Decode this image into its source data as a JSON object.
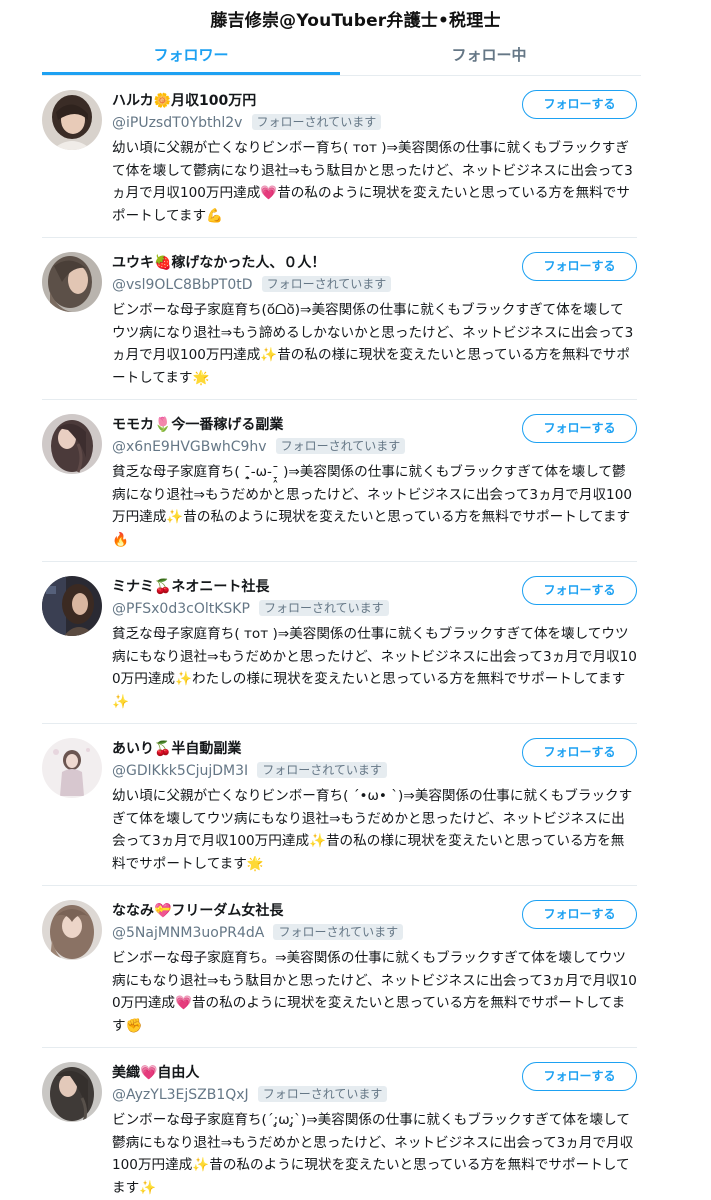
{
  "header": {
    "title": "藤吉修崇@YouTuber弁護士•税理士"
  },
  "tabs": [
    {
      "label": "フォロワー",
      "active": true
    },
    {
      "label": "フォロー中",
      "active": false
    }
  ],
  "colors": {
    "accent": "#1da1f2",
    "muted": "#657786",
    "badge_bg": "#e6ecf0"
  },
  "follows_you_label": "フォローされています",
  "follow_button_label": "フォローする",
  "users": [
    {
      "name": "ハルカ🌼月収100万円",
      "handle": "@iPUzsdT0Ybthl2v",
      "bio": "幼い頃に父親が亡くなりビンボー育ち( ᴛᴏᴛ )⇒美容関係の仕事に就くもブラックすぎて体を壊して鬱病になり退社⇒もう駄目かと思ったけど、ネットビジネスに出会って3ヵ月で月収100万円達成💗昔の私のように現状を変えたいと思っている方を無料でサポートしてます💪",
      "avatar": "avatar-1"
    },
    {
      "name": "ユウキ🍓稼げなかった人、０人！",
      "handle": "@vsl9OLC8BbPT0tD",
      "bio": "ビンボーな母子家庭育ち(o᷄ᗝo᷅)⇒美容関係の仕事に就くもブラックすぎて体を壊してウツ病になり退社⇒もう諦めるしかないかと思ったけど、ネットビジネスに出会って3ヵ月で月収100万円達成✨昔の私の様に現状を変えたいと思っている方を無料でサポートしてます🌟",
      "avatar": "avatar-2"
    },
    {
      "name": "モモカ🌷今一番稼げる副業",
      "handle": "@x6nE9HVGBwhC9hv",
      "bio": "貧乏な母子家庭育ち( ˉ̞̭-ω-ˉ̞̭ )⇒美容関係の仕事に就くもブラックすぎて体を壊して鬱病になり退社⇒もうだめかと思ったけど、ネットビジネスに出会って3ヵ月で月収100万円達成✨昔の私のように現状を変えたいと思っている方を無料でサポートしてます🔥",
      "avatar": "avatar-3"
    },
    {
      "name": "ミナミ🍒ネオニート社長",
      "handle": "@PFSx0d3cOltKSKP",
      "bio": "貧乏な母子家庭育ち( ᴛᴏᴛ )⇒美容関係の仕事に就くもブラックすぎて体を壊してウツ病にもなり退社⇒もうだめかと思ったけど、ネットビジネスに出会って3ヵ月で月収100万円達成✨わたしの様に現状を変えたいと思っている方を無料でサポートしてます✨",
      "avatar": "avatar-4"
    },
    {
      "name": "あいり🍒半自動副業",
      "handle": "@GDlKkk5CjujDM3I",
      "bio": "幼い頃に父親が亡くなりビンボー育ち( ˊ•ω• ˋ)⇒美容関係の仕事に就くもブラックすぎて体を壊してウツ病にもなり退社⇒もうだめかと思ったけど、ネットビジネスに出会って3ヵ月で月収100万円達成✨昔の私の様に現状を変えたいと思っている方を無料でサポートしてます🌟",
      "avatar": "avatar-5"
    },
    {
      "name": "ななみ💝フリーダム女社長",
      "handle": "@5NajMNM3uoPR4dA",
      "bio": "ビンボーな母子家庭育ち。⇒美容関係の仕事に就くもブラックすぎて体を壊してウツ病にもなり退社⇒もう駄目かと思ったけど、ネットビジネスに出会って3ヵ月で月収100万円達成💗昔の私のように現状を変えたいと思っている方を無料でサポートしてます✊",
      "avatar": "avatar-6"
    },
    {
      "name": "美織💗自由人",
      "handle": "@AyzYL3EjSZB1QxJ",
      "bio": "ビンボーな母子家庭育ち(ˊ;̥ω;̥ˋ)⇒美容関係の仕事に就くもブラックすぎて体を壊して鬱病にもなり退社⇒もうだめかと思ったけど、ネットビジネスに出会って3ヵ月で月収100万円達成✨昔の私のように現状を変えたいと思っている方を無料でサポートしてます✨",
      "avatar": "avatar-7"
    }
  ]
}
